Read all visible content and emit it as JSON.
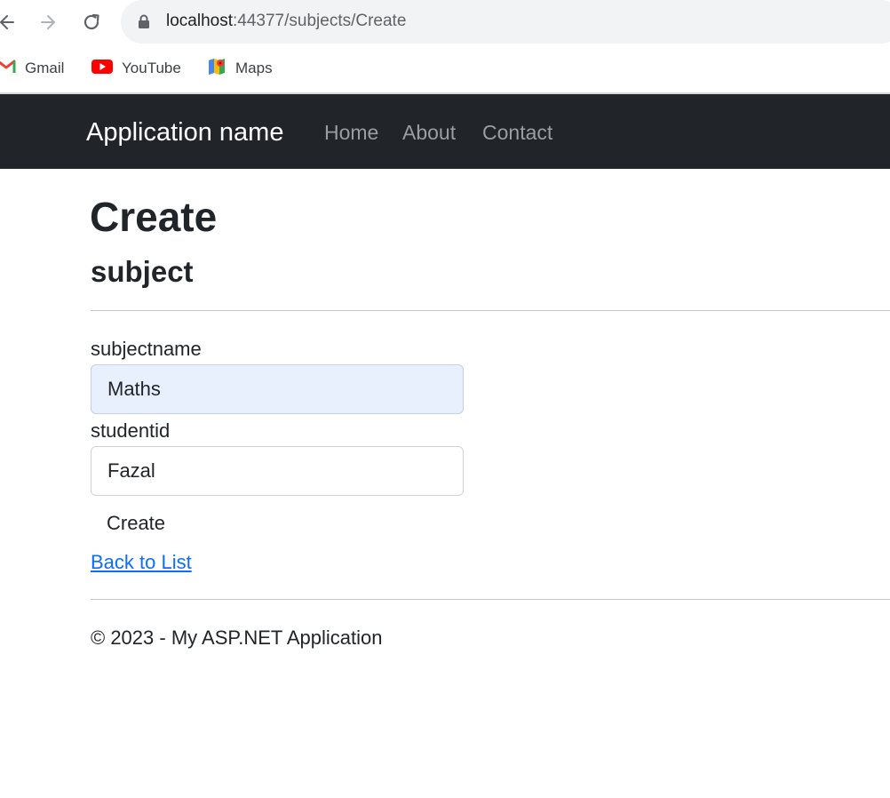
{
  "browser": {
    "url_host": "localhost",
    "url_path": ":44377/subjects/Create",
    "bookmarks": [
      {
        "label": "Gmail",
        "icon": "gmail-icon"
      },
      {
        "label": "YouTube",
        "icon": "youtube-icon"
      },
      {
        "label": "Maps",
        "icon": "maps-icon"
      }
    ]
  },
  "navbar": {
    "brand": "Application name",
    "links": [
      "Home",
      "About",
      "Contact"
    ]
  },
  "page": {
    "title": "Create",
    "subtitle": "subject"
  },
  "form": {
    "subjectname": {
      "label": "subjectname",
      "value": "Maths"
    },
    "studentid": {
      "label": "studentid",
      "value": "Fazal"
    },
    "submit_label": "Create"
  },
  "back_link": "Back to List",
  "footer": "© 2023 - My ASP.NET Application",
  "colors": {
    "navbar_bg": "#212529",
    "link": "#0d6efd",
    "autofill_bg": "#e8f0fe"
  }
}
